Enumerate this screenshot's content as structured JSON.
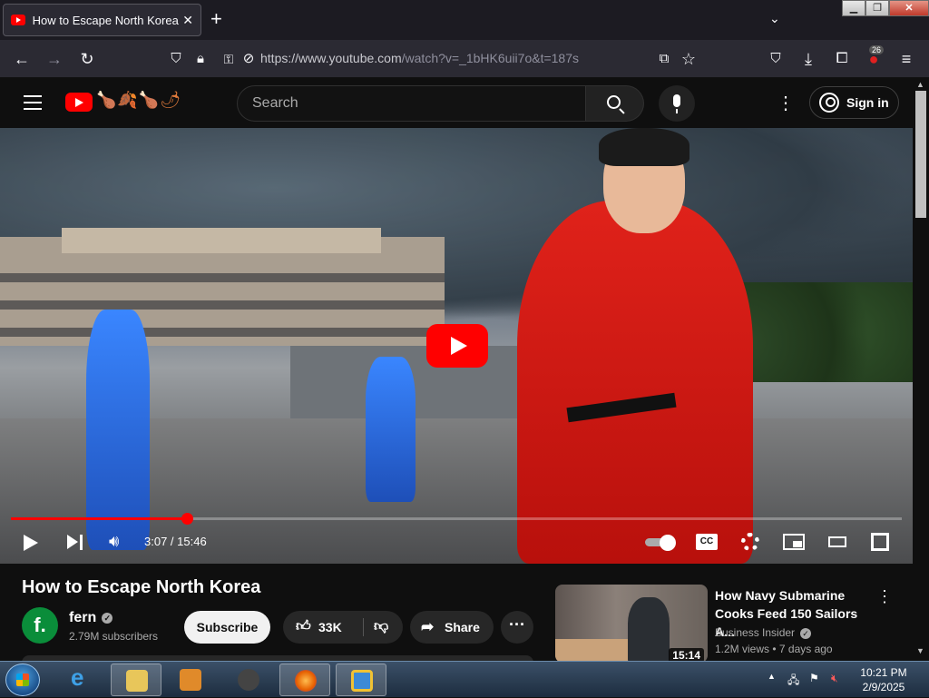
{
  "browser": {
    "tab_title": "How to Escape North Korea - Y",
    "tab_close": "✕",
    "new_tab": "+",
    "tab_list": "⌄",
    "url_host": "https://www.youtube.com",
    "url_path": "/watch?v=_1bHK6uii7o&t=187s",
    "extension_badge": "26",
    "window_buttons": {
      "minimize": "▁",
      "restore": "❐",
      "close": "✕"
    }
  },
  "youtube": {
    "logo_doodle": "🍗🍂🍗🌶",
    "search_placeholder": "Search",
    "menu_dots": "⋮",
    "sign_in_label": "Sign in"
  },
  "player": {
    "current_time": "3:07",
    "duration": "15:46",
    "time_display": "3:07 / 15:46",
    "progress_fraction": 0.198,
    "cc_label": "CC"
  },
  "video": {
    "title": "How to Escape North Korea",
    "channel_name": "fern",
    "channel_initial": "f.",
    "subscribers": "2.79M subscribers",
    "subscribe_label": "Subscribe",
    "like_count": "33K",
    "share_label": "Share",
    "more_label": "···"
  },
  "recommendation": {
    "title": "How Navy Submarine Cooks Feed 150 Sailors A...",
    "channel": "Business Insider",
    "views": "1.2M views",
    "age": "7 days ago",
    "meta": "1.2M views • 7 days ago",
    "duration": "15:14"
  },
  "taskbar": {
    "time": "10:21 PM",
    "date": "2/9/2025"
  },
  "colors": {
    "youtube_red": "#ff0000",
    "background": "#0f0f0f",
    "browser_chrome": "#2b2a33"
  }
}
